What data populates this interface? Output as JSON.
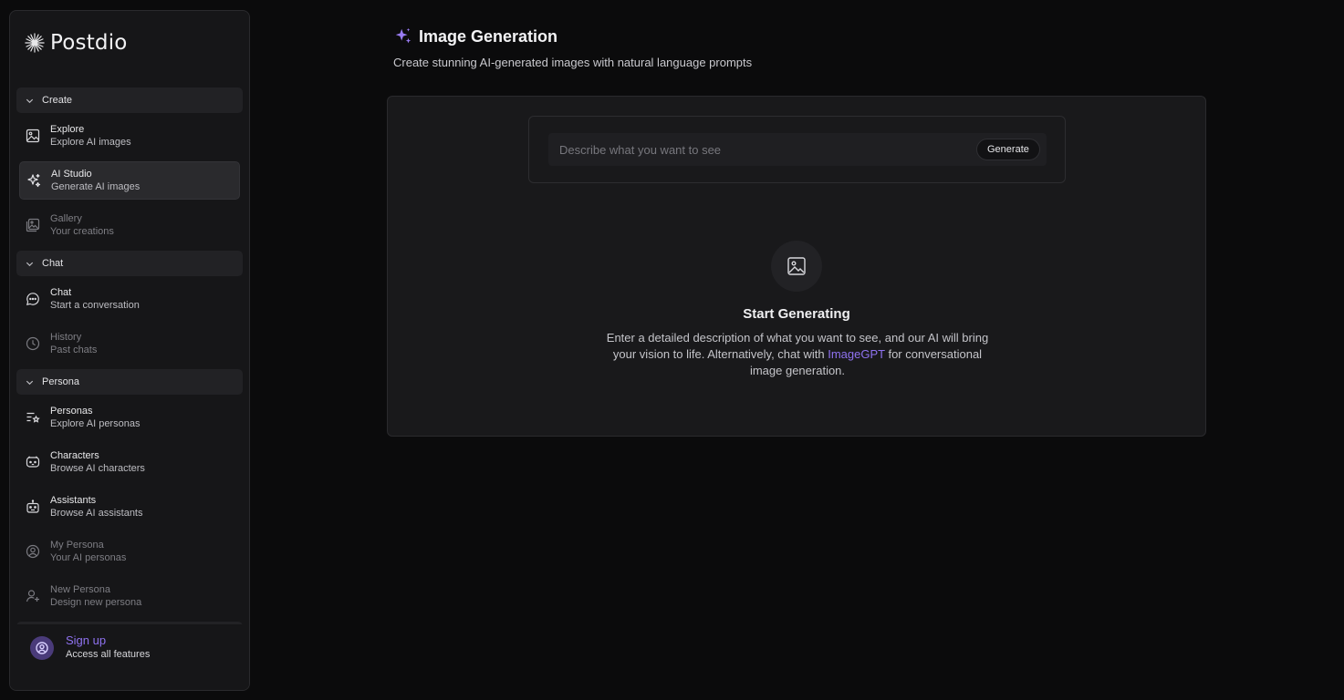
{
  "brand": {
    "name": "Postdio"
  },
  "sidebar": {
    "sections": [
      {
        "header": "Create",
        "items": [
          {
            "title": "Explore",
            "subtitle": "Explore AI images",
            "icon": "image-icon",
            "state": "normal"
          },
          {
            "title": "AI Studio",
            "subtitle": "Generate AI images",
            "icon": "sparkles-icon",
            "state": "active"
          },
          {
            "title": "Gallery",
            "subtitle": "Your creations",
            "icon": "gallery-icon",
            "state": "dim"
          }
        ]
      },
      {
        "header": "Chat",
        "items": [
          {
            "title": "Chat",
            "subtitle": "Start a conversation",
            "icon": "chat-bubble-icon",
            "state": "normal"
          },
          {
            "title": "History",
            "subtitle": "Past chats",
            "icon": "clock-icon",
            "state": "dim"
          }
        ]
      },
      {
        "header": "Persona",
        "items": [
          {
            "title": "Personas",
            "subtitle": "Explore AI personas",
            "icon": "list-star-icon",
            "state": "normal"
          },
          {
            "title": "Characters",
            "subtitle": "Browse AI characters",
            "icon": "cat-face-icon",
            "state": "normal"
          },
          {
            "title": "Assistants",
            "subtitle": "Browse AI assistants",
            "icon": "robot-icon",
            "state": "normal"
          },
          {
            "title": "My Persona",
            "subtitle": "Your AI personas",
            "icon": "user-circle-icon",
            "state": "dim"
          },
          {
            "title": "New Persona",
            "subtitle": "Design new persona",
            "icon": "user-plus-icon",
            "state": "dim"
          }
        ]
      }
    ],
    "signup": {
      "title": "Sign up",
      "subtitle": "Access all features"
    }
  },
  "main": {
    "title": "Image Generation",
    "subtitle": "Create stunning AI-generated images with natural language prompts",
    "prompt": {
      "placeholder": "Describe what you want to see",
      "button": "Generate"
    },
    "empty": {
      "title": "Start Generating",
      "desc_before": "Enter a detailed description of what you want to see, and our AI will bring your vision to life. Alternatively, chat with ",
      "link": "ImageGPT",
      "desc_after": " for conversational image generation."
    }
  },
  "colors": {
    "accent": "#8f72f0",
    "background": "#0b0b0c",
    "panel": "#19191b"
  }
}
